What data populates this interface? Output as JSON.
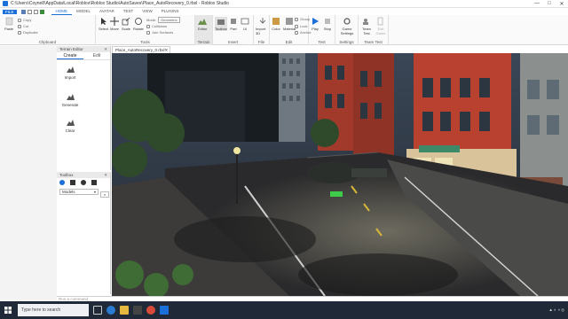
{
  "window": {
    "title": "C:\\Users\\Coyne8\\AppData\\Local\\Roblox\\Roblox Studio\\AutoSaves\\Place_AutoRecovery_0.rbxl - Roblox Studio",
    "minimize": "—",
    "maximize": "□",
    "close": "✕"
  },
  "menu": {
    "file": "FILE",
    "tabs": [
      "HOME",
      "MODEL",
      "AVATAR",
      "TEST",
      "VIEW",
      "PLUGINS"
    ],
    "active_tab": "HOME"
  },
  "ribbon": {
    "clipboard": {
      "label": "Clipboard",
      "paste": "Paste",
      "copy": "Copy",
      "cut": "Cut",
      "duplicate": "Duplicate"
    },
    "tools": {
      "label": "Tools",
      "select": "Select",
      "move": "Move",
      "scale": "Scale",
      "rotate": "Rotate",
      "mode_label": "Mode:",
      "mode_value": "Geometric",
      "collisions": "Collisions",
      "join": "Join Surfaces"
    },
    "terrain": {
      "label": "Terrain",
      "editor": "Editor"
    },
    "insert": {
      "label": "Insert",
      "toolbox": "Toolbox",
      "part": "Part",
      "ui": "UI"
    },
    "file": {
      "label": "File",
      "import3d": "Import 3D"
    },
    "edit": {
      "label": "Edit",
      "color": "Color",
      "material": "Material",
      "group": "Group",
      "lock": "Lock",
      "anchor": "Anchor"
    },
    "test": {
      "label": "Test",
      "play": "Play",
      "stop": "Stop"
    },
    "settings": {
      "label": "Settings",
      "game_settings": "Game Settings"
    },
    "team_test": {
      "label": "Team Test",
      "team_test": "Team Test",
      "exit_game": "Exit Game"
    }
  },
  "terrain_panel": {
    "title": "Terrain Editor",
    "tabs": [
      "Create",
      "Edit"
    ],
    "active_tab": "Create",
    "items": [
      "Import",
      "Generate",
      "Clear"
    ]
  },
  "toolbox": {
    "title": "Toolbox",
    "category": "Models",
    "search_icon": "magnifier"
  },
  "document": {
    "tab": "Place_AutoRecovery_0.rbxl"
  },
  "command_bar": {
    "placeholder": "Run a command"
  },
  "taskbar": {
    "search": "Type here to search"
  },
  "colors": {
    "accent": "#1b6fd8",
    "taskbar": "#1f2937",
    "brick": "#b8412f"
  }
}
